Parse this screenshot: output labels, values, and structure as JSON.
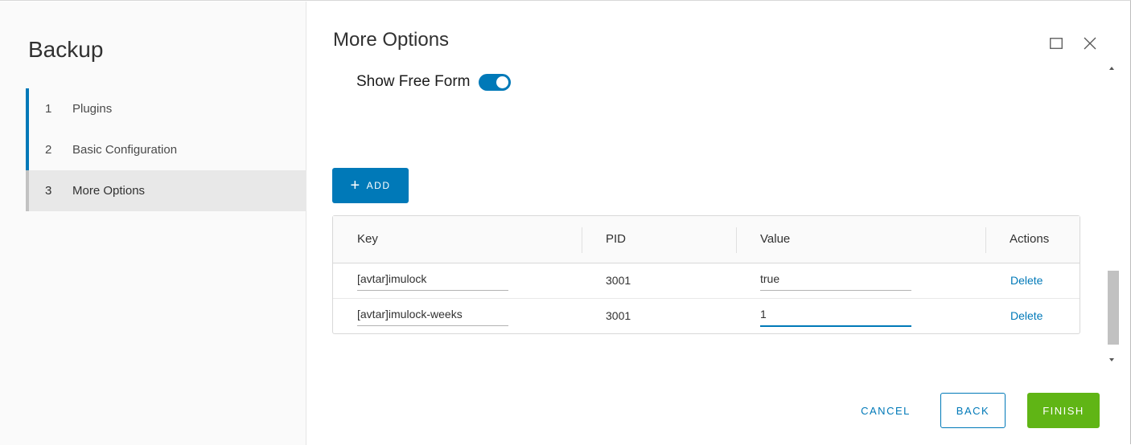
{
  "sidebar": {
    "title": "Backup",
    "steps": [
      {
        "num": "1",
        "label": "Plugins"
      },
      {
        "num": "2",
        "label": "Basic Configuration"
      },
      {
        "num": "3",
        "label": "More Options"
      }
    ],
    "active_step": 3
  },
  "main": {
    "title": "More Options",
    "show_free_form_label": "Show Free Form",
    "show_free_form_enabled": true,
    "add_label": "ADD",
    "add_icon": "plus-icon"
  },
  "grid": {
    "columns": [
      "Key",
      "PID",
      "Value",
      "Actions"
    ],
    "rows": [
      {
        "key": "[avtar]imulock",
        "pid": "3001",
        "value": "true",
        "action": "Delete"
      },
      {
        "key": "[avtar]imulock-weeks",
        "pid": "3001",
        "value": "1",
        "action": "Delete"
      }
    ]
  },
  "footer": {
    "cancel": "CANCEL",
    "back": "BACK",
    "finish": "FINISH"
  },
  "colors": {
    "accent": "#0079b8",
    "finish": "#60b515"
  },
  "icons": {
    "maximize": "maximize-icon",
    "close": "close-icon"
  }
}
